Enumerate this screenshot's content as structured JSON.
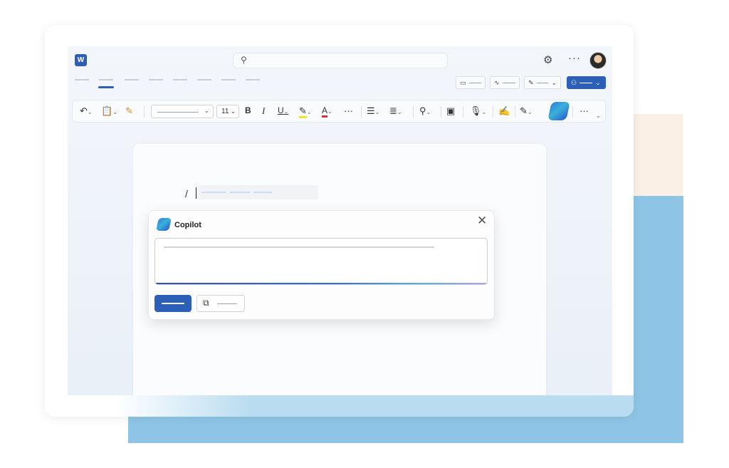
{
  "app": {
    "logo_letter": "W",
    "title_icons": [
      "search-icon",
      "gear-icon",
      "more-icon",
      "avatar"
    ]
  },
  "toolbar": {
    "font_size": "11",
    "bold": "B",
    "italic": "I",
    "underline": "U",
    "font_color": "A",
    "more": "···"
  },
  "document": {
    "typed_text": "/"
  },
  "copilot": {
    "title": "Copilot",
    "close": "✕",
    "prompt_placeholder": "",
    "colors": {
      "accent": "#2b5fb8",
      "glow_start": "#2b4fbf",
      "glow_end": "#b7a1e6"
    }
  },
  "colors": {
    "brand": "#2b5fb8",
    "backdrop_blue": "#8ec5e6",
    "backdrop_peach": "#fbf0e6"
  }
}
